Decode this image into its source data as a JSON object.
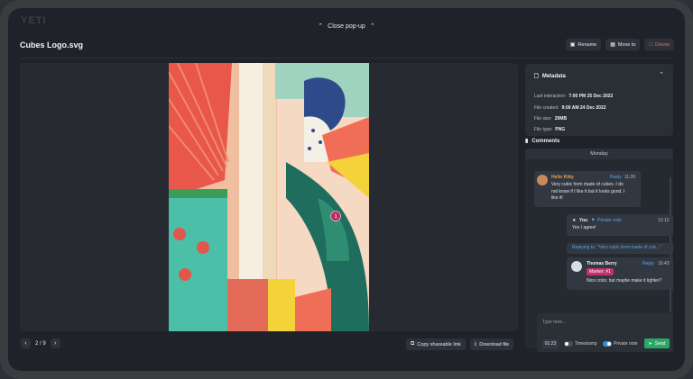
{
  "app": {
    "logo": "YETI"
  },
  "topbar": {
    "close_popup": "Close pop-up"
  },
  "file": {
    "title": "Cubes Logo.svg"
  },
  "actions": {
    "rename": "Rename",
    "move_to": "Move to",
    "delete": "Delete"
  },
  "pager": {
    "current": "2 / 9"
  },
  "bottom_actions": {
    "copy_link": "Copy shareable link",
    "download": "Download file"
  },
  "marker": {
    "number": "1"
  },
  "metadata": {
    "title": "Metadata",
    "rows": [
      {
        "label": "Last interaction:",
        "value": "7:00 PM 25 Dec 2022"
      },
      {
        "label": "File created:",
        "value": "9:00 AM 24 Dec 2022"
      },
      {
        "label": "File size:",
        "value": "20MB"
      },
      {
        "label": "File type:",
        "value": "PNG"
      }
    ]
  },
  "comments": {
    "title": "Comments",
    "day": "Monday",
    "items": [
      {
        "author": "Hello Kitty",
        "reply": "Reply",
        "time": "11:20",
        "text": [
          "Very cubic form made of cubes. I do",
          "not know if I like it but it looks good. I",
          "like it!"
        ]
      },
      {
        "author": "You",
        "private": "Private note",
        "time": "12:12",
        "text": [
          "Yes I agree!"
        ]
      },
      {
        "replying": "Replying to: \"Very cubic form made of cub...\""
      },
      {
        "author": "Thomas Berry",
        "reply": "Reply",
        "time": "16:43",
        "marker": "Marker: #1",
        "text": [
          "Nice color, but maybe make it lighter?"
        ]
      }
    ],
    "input": {
      "placeholder": "Type here...",
      "time": "01:23",
      "timestamp": "Timestamp",
      "private": "Private note",
      "send": "Send"
    }
  },
  "colors": {
    "accent_blue": "#5aa4e3",
    "send_green": "#29a86a",
    "delete_red": "#e06a6a",
    "marker_pink": "#c2306b",
    "author_orange": "#f2a33a"
  }
}
